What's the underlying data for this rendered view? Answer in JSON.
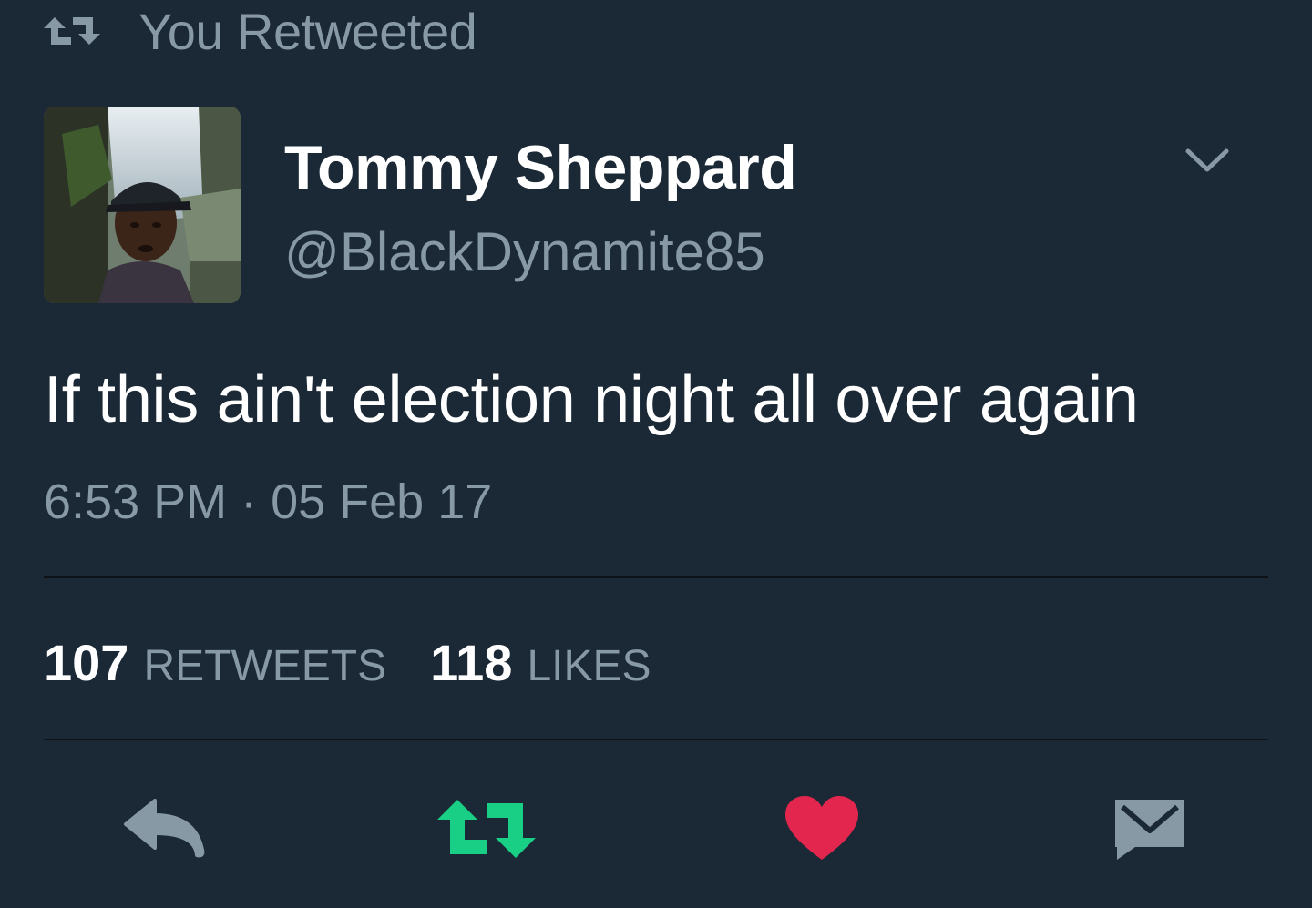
{
  "retweet_context": {
    "label": "You Retweeted",
    "icon": "retweet-icon",
    "color": "#8899a6"
  },
  "author": {
    "display_name": "Tommy Sheppard",
    "handle": "@BlackDynamite85",
    "avatar": "avatar-photo"
  },
  "tweet": {
    "text": "If this ain't election night all over again",
    "timestamp": "6:53 PM · 05 Feb 17"
  },
  "stats": {
    "retweets_count": "107",
    "retweets_label": "RETWEETS",
    "likes_count": "118",
    "likes_label": "LIKES"
  },
  "actions": [
    {
      "icon": "reply-icon",
      "color": "#8899a6"
    },
    {
      "icon": "retweet-icon",
      "color": "#19cf86"
    },
    {
      "icon": "heart-icon",
      "color": "#e2264d"
    },
    {
      "icon": "envelope-icon",
      "color": "#8899a6"
    }
  ],
  "colors": {
    "background": "#1b2836",
    "text_primary": "#ffffff",
    "text_secondary": "#8899a6",
    "retweet_active": "#19cf86",
    "like_active": "#e2264d",
    "divider": "#0c1218"
  }
}
